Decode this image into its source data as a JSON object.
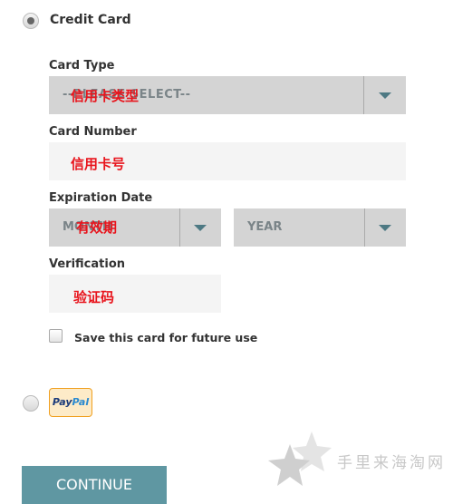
{
  "credit_card": {
    "label": "Credit Card",
    "selected": true,
    "card_type": {
      "label": "Card Type",
      "placeholder": "--PLEASE SELECT--",
      "annotation": "信用卡类型"
    },
    "card_number": {
      "label": "Card Number",
      "value": "",
      "annotation": "信用卡号"
    },
    "expiration": {
      "label": "Expiration Date",
      "month_placeholder": "MONTH",
      "year_placeholder": "YEAR",
      "annotation": "有效期"
    },
    "verification": {
      "label": "Verification",
      "value": "",
      "annotation": "验证码"
    },
    "save_card": {
      "label": "Save this card for future use",
      "checked": false
    }
  },
  "paypal": {
    "selected": false,
    "logo_text_1": "Pay",
    "logo_text_2": "Pal"
  },
  "continue_label": "CONTINUE",
  "watermark": "手里来海淘网",
  "colors": {
    "accent": "#5f97a2",
    "annotation": "#e8141c",
    "arrow": "#4d7983"
  }
}
